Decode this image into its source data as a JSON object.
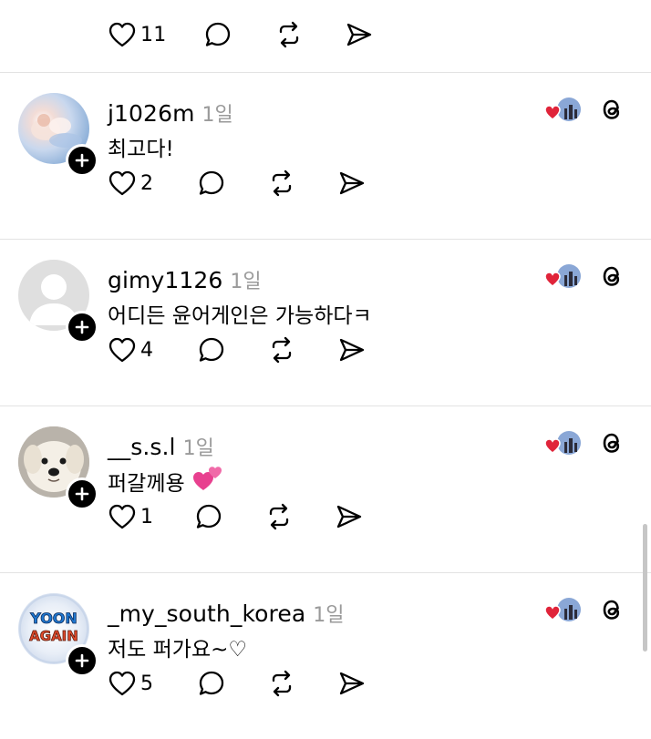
{
  "top_actions": {
    "like_count": "11"
  },
  "posts": [
    {
      "username": "j1026m",
      "time": "1일",
      "text": "최고다!",
      "like_count": "2",
      "avatar": "sky-figure-avatar"
    },
    {
      "username": "gimy1126",
      "time": "1일",
      "text": "어디든 윤어게인은 가능하다ㅋ",
      "like_count": "4",
      "avatar": "default-avatar"
    },
    {
      "username": "__s.s.l",
      "time": "1일",
      "text": "퍼갈께용",
      "like_count": "1",
      "avatar": "puppy-avatar",
      "emoji": "two-hearts-emoji"
    },
    {
      "username": "_my_south_korea",
      "time": "1일",
      "text": "저도 퍼가요~♡",
      "like_count": "5",
      "avatar": "yoon-again-avatar"
    }
  ],
  "colors": {
    "text": "#000000",
    "muted": "#9a9a9a",
    "divider": "#e3e3e3",
    "heart": "#e0243a",
    "emoji_pink": "#e8408f"
  },
  "icons": [
    "heart-icon",
    "comment-icon",
    "repost-icon",
    "share-icon",
    "follow-plus-icon",
    "threads-icon",
    "liked-by-author-badge"
  ]
}
